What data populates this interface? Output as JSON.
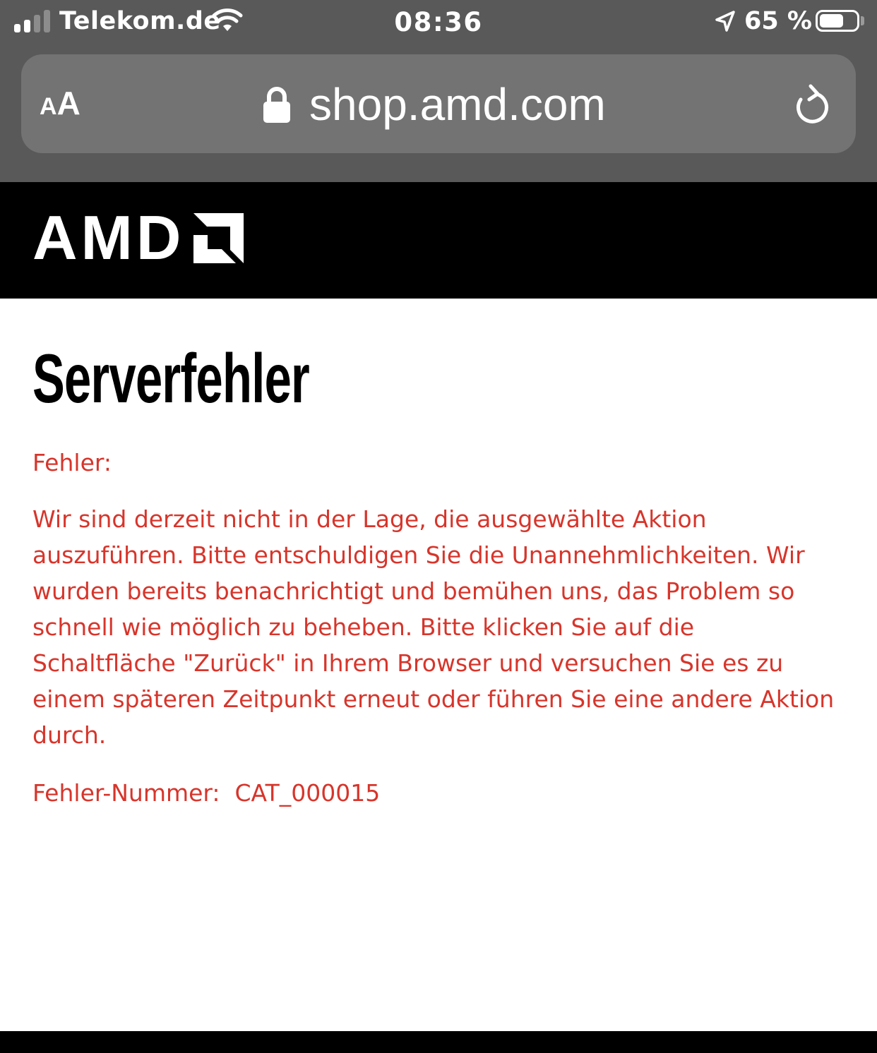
{
  "status_bar": {
    "carrier": "Telekom.de",
    "time": "08:36",
    "battery_percent": "65 %",
    "battery_level": 0.65
  },
  "browser": {
    "text_size_label": {
      "small": "A",
      "large": "A"
    },
    "url": "shop.amd.com"
  },
  "header": {
    "logo_text": "AMD"
  },
  "main": {
    "title": "Serverfehler",
    "error_label": "Fehler:",
    "error_message": "Wir sind derzeit nicht in der Lage, die ausgewählte Aktion auszuführen. Bitte entschuldigen Sie die Unannehmlichkeiten. Wir wurden bereits benachrichtigt und bemühen uns, das Problem so schnell wie möglich zu beheben. Bitte klicken Sie auf die Schaltfläche \"Zurück\" in Ihrem Browser und versuchen Sie es zu einem späteren Zeitpunkt erneut oder führen Sie eine andere Aktion durch.",
    "error_number": "Fehler-Nummer:  CAT_000015"
  },
  "colors": {
    "error_text": "#d7352b",
    "header_bg": "#000000",
    "chrome_bg": "#595959",
    "url_field_bg": "#737373"
  },
  "icons": [
    "signal-icon",
    "wifi-icon",
    "location-icon",
    "battery-icon",
    "lock-icon",
    "reload-icon",
    "amd-arrow-logo"
  ]
}
